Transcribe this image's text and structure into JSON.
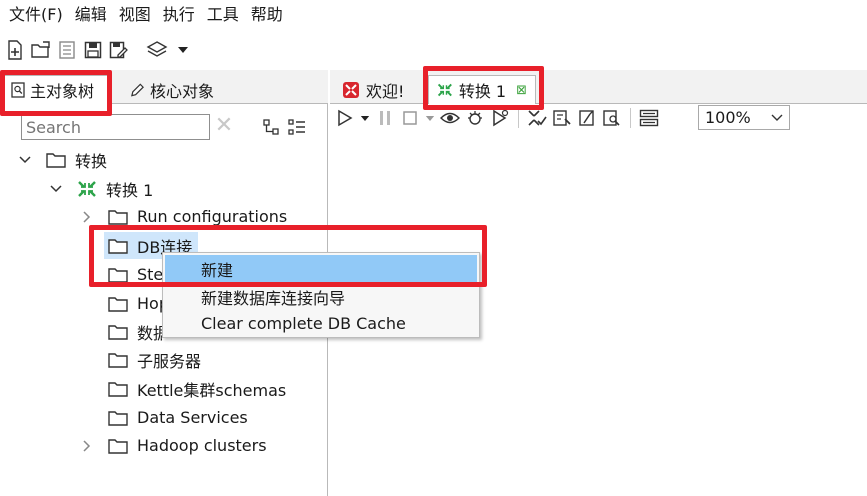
{
  "menu": [
    {
      "name": "menu-file",
      "label": "文件(F)"
    },
    {
      "name": "menu-edit",
      "label": "编辑"
    },
    {
      "name": "menu-view",
      "label": "视图"
    },
    {
      "name": "menu-run",
      "label": "执行"
    },
    {
      "name": "menu-tools",
      "label": "工具"
    },
    {
      "name": "menu-help",
      "label": "帮助"
    }
  ],
  "left_tabs": {
    "main_tree": "主对象树",
    "core_objects": "核心对象"
  },
  "search": {
    "placeholder": "Search"
  },
  "tree": {
    "root": "转换",
    "trans": "转换 1",
    "items": {
      "run_configurations": "Run configurations",
      "db_connections": "DB连接",
      "steps": "Steps",
      "hops": "Hops",
      "partitions": "数据库分区schemas",
      "slave_servers": "子服务器",
      "kettle_cluster": "Kettle集群schemas",
      "data_services": "Data Services",
      "hadoop_clusters": "Hadoop clusters"
    }
  },
  "right_tabs": {
    "welcome": "欢迎!",
    "trans": "转换 1"
  },
  "zoom": {
    "value": "100%"
  },
  "context_menu": [
    {
      "name": "context-menu-new",
      "label": "新建"
    },
    {
      "name": "context-menu-new-wizard",
      "label": "新建数据库连接向导"
    },
    {
      "name": "context-menu-clear-cache",
      "label": "Clear complete DB Cache"
    }
  ],
  "colors": {
    "annotation": "#e8202a",
    "selection": "#cfe6fb",
    "menu_hover": "#91c9f7",
    "trans_icon": "#2ca44a",
    "welcome_icon": "#d8262e"
  },
  "icons": {
    "new_file": "new-file-icon",
    "open": "open-folder-icon",
    "explore": "repository-explorer-icon",
    "save": "save-icon",
    "save_as": "save-as-icon",
    "layers": "layers-icon",
    "run": "play-icon",
    "pause": "pause-icon",
    "stop": "stop-icon",
    "preview": "eye-icon",
    "debug": "debug-icon",
    "replay": "replay-icon",
    "verify": "verify-icon",
    "impact": "impact-icon",
    "sql": "sql-icon",
    "explore_db": "explore-db-icon",
    "show_results": "show-results-icon"
  }
}
